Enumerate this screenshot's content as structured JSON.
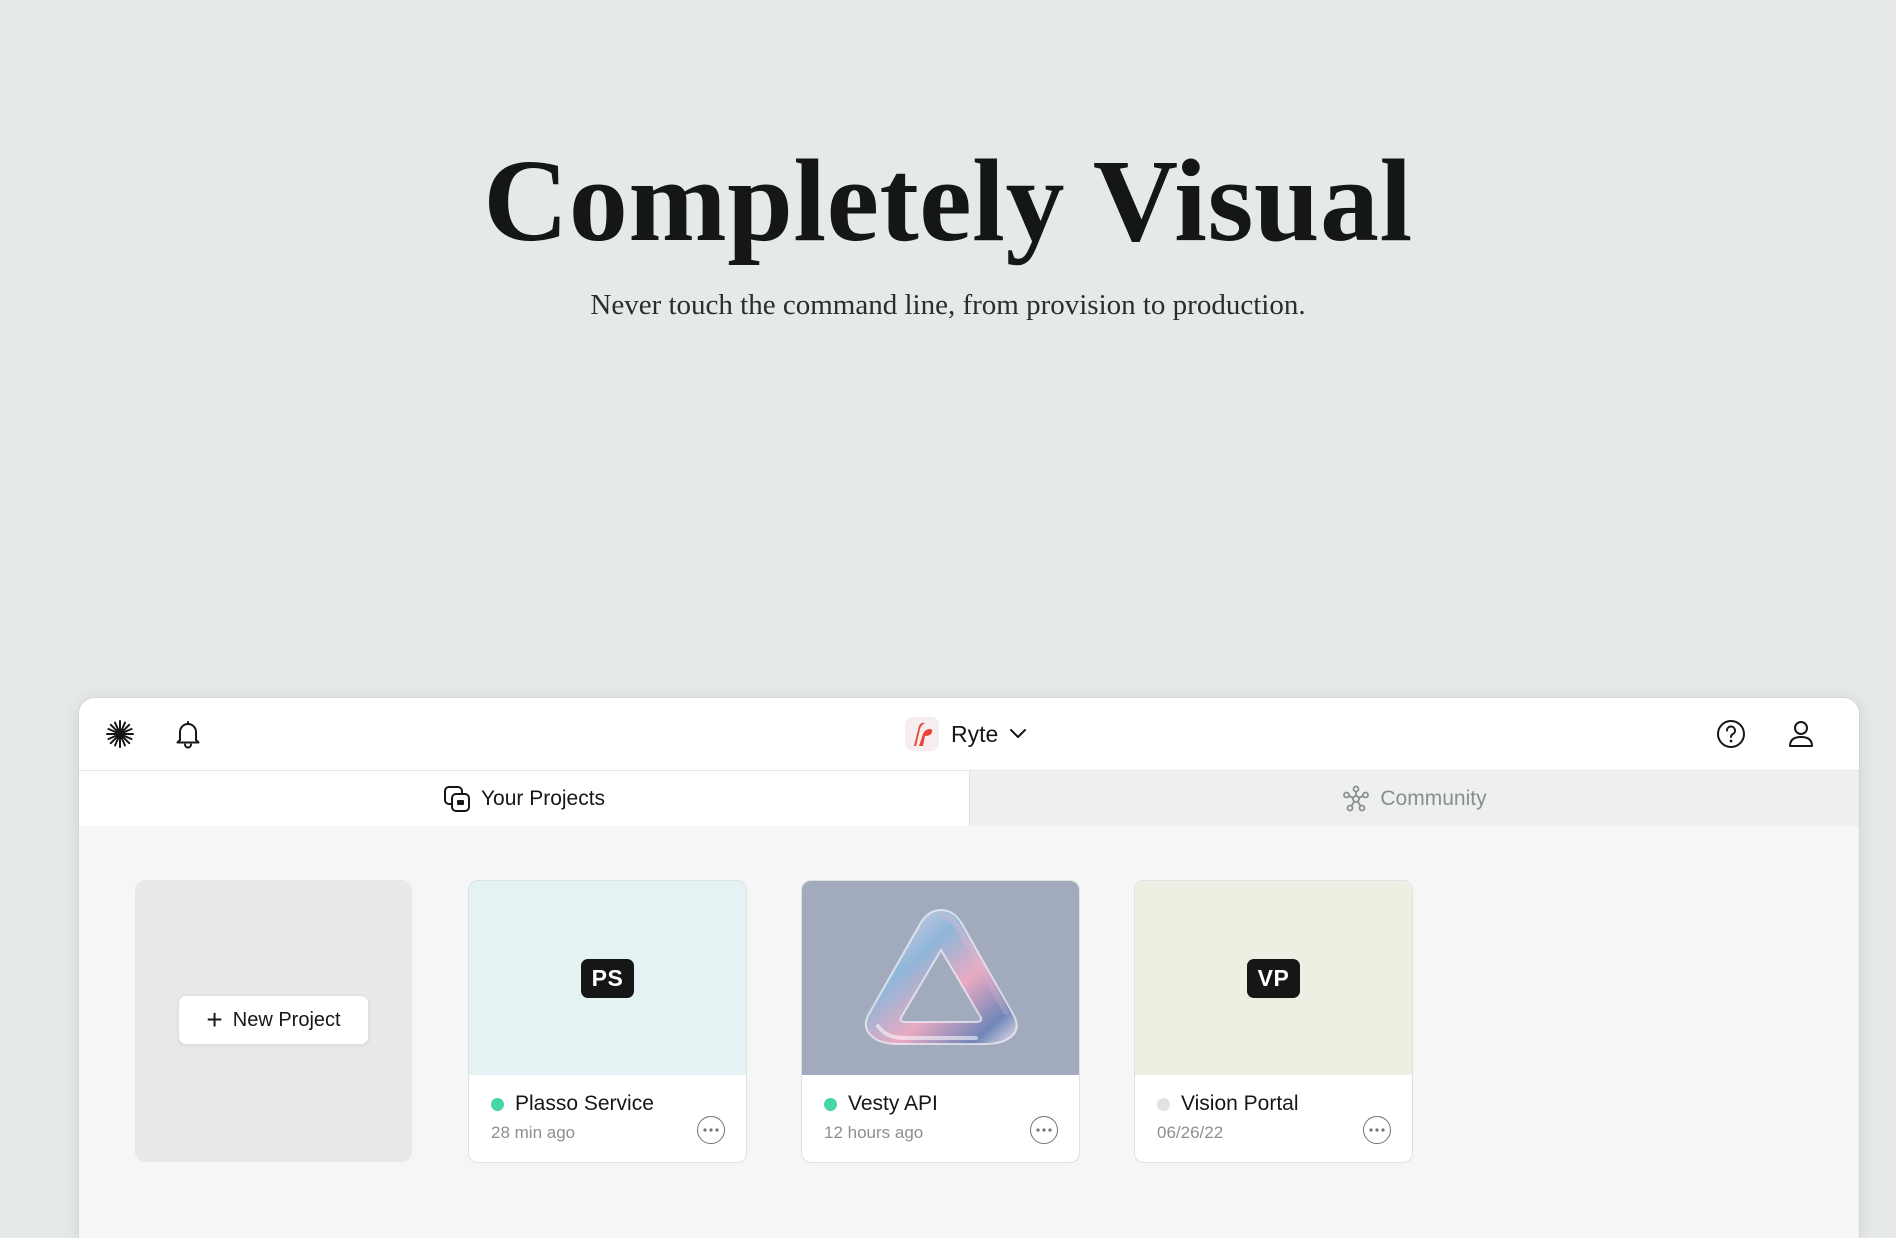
{
  "hero": {
    "title": "Completely Visual",
    "subtitle": "Never touch the command line, from provision to production."
  },
  "topbar": {
    "left_icons": [
      "sparkle-icon",
      "bell-icon"
    ],
    "workspace": {
      "name": "Ryte",
      "logo_color": "#e8443a"
    },
    "right_icons": [
      "help-icon",
      "user-icon"
    ]
  },
  "tabs": [
    {
      "label": "Your Projects",
      "icon": "projects-icon",
      "active": true
    },
    {
      "label": "Community",
      "icon": "community-icon",
      "active": false
    }
  ],
  "new_project": {
    "label": "New Project"
  },
  "projects": [
    {
      "initials": "PS",
      "name": "Plasso Service",
      "time": "28 min ago",
      "status": "active",
      "status_color": "#46d6a8",
      "thumb_bg": "#e5f2f3"
    },
    {
      "initials": "",
      "name": "Vesty API",
      "time": "12 hours ago",
      "status": "active",
      "status_color": "#46d6a8",
      "thumb_bg": "#a2abbd"
    },
    {
      "initials": "VP",
      "name": "Vision Portal",
      "time": "06/26/22",
      "status": "inactive",
      "status_color": "#e1e3e2",
      "thumb_bg": "#efeee3"
    }
  ]
}
